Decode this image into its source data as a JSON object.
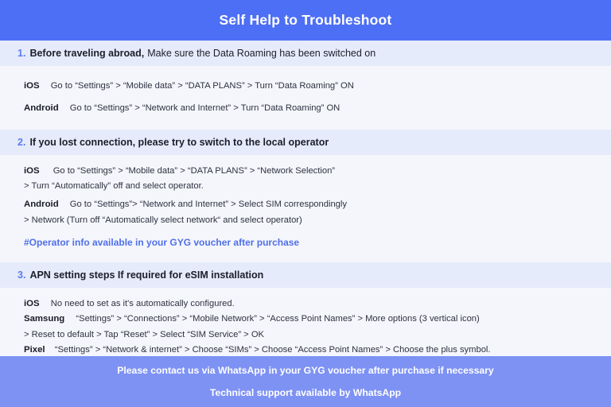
{
  "header": {
    "title": "Self Help to Troubleshoot",
    "background_color": "#4d6ff5",
    "text_color": "#ffffff"
  },
  "theme": {
    "page_background": "#f5f6fb",
    "band_background": "#e5ebfa",
    "accent_blue": "#5a7bf0",
    "note_blue": "#4f6fe8",
    "footer_background": "#7e92f4",
    "body_text": "#262a38"
  },
  "sections": [
    {
      "number": "1.",
      "lead": "Before traveling abroad,",
      "rest": "Make sure the Data Roaming has been switched on",
      "rows": [
        {
          "platform": "iOS",
          "steps": "Go to “Settings” > “Mobile data” > “DATA PLANS” > Turn “Data Roaming” ON"
        },
        {
          "platform": "Android",
          "steps": "Go to “Settings” > “Network and Internet” > Turn “Data Roaming” ON"
        }
      ]
    },
    {
      "number": "2.",
      "lead": "If you lost connection, please try to switch to the local operator",
      "rest": "",
      "rows": [
        {
          "platform": "iOS",
          "steps": "Go to “Settings” > “Mobile data” > “DATA PLANS” > “Network Selection”"
        },
        {
          "platform": "",
          "steps": "> Turn “Automatically” off and select operator."
        },
        {
          "platform": "Android",
          "steps": "Go to “Settings”>  “Network and Internet” > Select SIM correspondingly"
        },
        {
          "platform": "",
          "steps": "> Network (Turn off “Automatically select network“ and select operator)"
        }
      ],
      "note": "#Operator info available in your GYG voucher after purchase"
    },
    {
      "number": "3.",
      "lead": "APN setting steps If required for eSIM installation",
      "rest": "",
      "rows": [
        {
          "platform": "iOS",
          "steps": "No need to set as it's automatically configured."
        },
        {
          "platform": "Samsung",
          "steps": "“Settings” > “Connections” > “Mobile Network” > “Access Point Names” > More options (3 vertical icon)"
        },
        {
          "platform": "",
          "steps": "> Reset to default > Tap “Reset” > Select “SIM Service” > OK"
        },
        {
          "platform": "Pixel",
          "steps": "“Settings” > “Network & internet” > Choose “SIMs” > Choose “Access Point Names” > Choose the plus symbol."
        }
      ]
    }
  ],
  "footer": {
    "line1": "Please contact us via WhatsApp  in your GYG voucher after purchase if necessary",
    "line2": "Technical support available by WhatsApp"
  }
}
